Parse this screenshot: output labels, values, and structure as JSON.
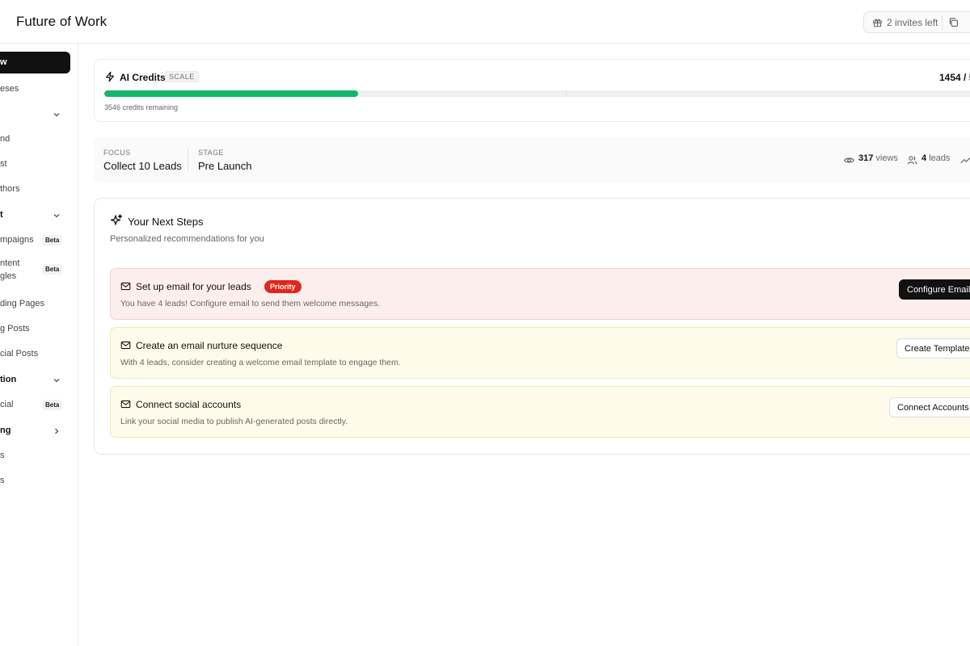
{
  "header": {
    "title": "Future of Work",
    "invites_label": "2 invites left"
  },
  "sidebar": {
    "items": [
      {
        "label": "w",
        "kind": "active"
      },
      {
        "label": "eses",
        "kind": "item"
      },
      {
        "label": "",
        "kind": "section",
        "chevron": "down"
      },
      {
        "label": "nd",
        "kind": "item"
      },
      {
        "label": "st",
        "kind": "item"
      },
      {
        "label": "thors",
        "kind": "item"
      },
      {
        "label": "t",
        "kind": "section",
        "chevron": "down"
      },
      {
        "label": "mpaigns",
        "kind": "item",
        "badge": "Beta"
      },
      {
        "label": "ntent\ngles",
        "kind": "item",
        "badge": "Beta"
      },
      {
        "label": "ding Pages",
        "kind": "item"
      },
      {
        "label": "g Posts",
        "kind": "item"
      },
      {
        "label": "cial Posts",
        "kind": "item"
      },
      {
        "label": "tion",
        "kind": "section",
        "chevron": "down"
      },
      {
        "label": "cial",
        "kind": "item",
        "badge": "Beta"
      },
      {
        "label": "ng",
        "kind": "section",
        "chevron": "right"
      },
      {
        "label": "s",
        "kind": "item"
      },
      {
        "label": "s",
        "kind": "item"
      }
    ]
  },
  "credits": {
    "title": "AI Credits",
    "plan": "SCALE",
    "count": "1454 / 5",
    "remaining": "3546 credits remaining",
    "used_fraction": 0.2908,
    "accent_color": "#12b76a"
  },
  "focus": {
    "focus_label": "FOCUS",
    "focus_value": "Collect 10 Leads",
    "stage_label": "STAGE",
    "stage_value": "Pre Launch",
    "views_count": "317",
    "views_label": "views",
    "leads_count": "4",
    "leads_label": "leads"
  },
  "next_steps": {
    "title": "Your Next Steps",
    "subtitle": "Personalized recommendations for you",
    "steps": [
      {
        "title": "Set up email for your leads",
        "badge": "Priority",
        "description": "You have 4 leads! Configure email to send them welcome messages.",
        "button": "Configure Email"
      },
      {
        "title": "Create an email nurture sequence",
        "description": "With 4 leads, consider creating a welcome email template to engage them.",
        "button": "Create Template"
      },
      {
        "title": "Connect social accounts",
        "description": "Link your social media to publish AI-generated posts directly.",
        "button": "Connect Accounts"
      }
    ]
  }
}
